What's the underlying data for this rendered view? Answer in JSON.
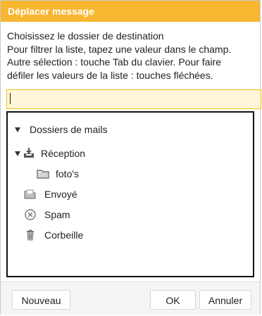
{
  "dialog": {
    "title": "Déplacer message",
    "instructions": [
      "Choisissez le dossier de destination",
      "Pour filtrer la liste, tapez une valeur dans le champ.",
      "Autre sélection : touche Tab du clavier. Pour faire",
      "défiler les valeurs de la liste : touches fléchées."
    ],
    "filter_value": ""
  },
  "tree": {
    "root_label": "Dossiers de mails",
    "items": [
      {
        "label": "Réception",
        "icon": "inbox-icon"
      },
      {
        "label": "foto's",
        "icon": "folder-icon"
      },
      {
        "label": "Envoyé",
        "icon": "sent-icon"
      },
      {
        "label": "Spam",
        "icon": "spam-icon"
      },
      {
        "label": "Corbeille",
        "icon": "trash-icon"
      }
    ]
  },
  "buttons": {
    "new": "Nouveau",
    "ok": "OK",
    "cancel": "Annuler"
  },
  "colors": {
    "titlebar": "#f7b731",
    "filter_bg": "#fdf6d8",
    "filter_border": "#f1c40f"
  }
}
